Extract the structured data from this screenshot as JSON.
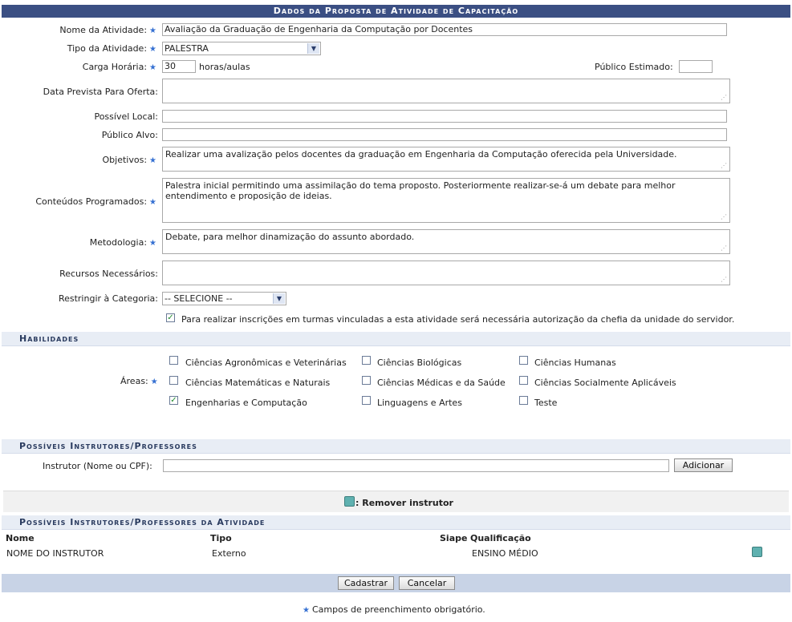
{
  "title": "Dados da Proposta de Atividade de Capacitação",
  "fields": {
    "nome_label": "Nome da Atividade:",
    "nome_value": "Avaliação da Graduação de Engenharia da Computação por Docentes",
    "tipo_label": "Tipo da Atividade:",
    "tipo_value": "PALESTRA",
    "carga_label": "Carga Horária:",
    "carga_value": "30",
    "carga_unit": "horas/aulas",
    "publico_estimado_label": "Público Estimado:",
    "publico_estimado_value": "",
    "data_prevista_label": "Data Prevista Para Oferta:",
    "data_prevista_value": "",
    "local_label": "Possível Local:",
    "local_value": "",
    "publico_alvo_label": "Público Alvo:",
    "publico_alvo_value": "",
    "objetivos_label": "Objetivos:",
    "objetivos_value": "Realizar uma avalização pelos docentes da graduação em Engenharia da Computação oferecida pela Universidade.",
    "conteudos_label": "Conteúdos Programados:",
    "conteudos_value": "Palestra inicial permitindo uma assimilação do tema proposto. Posteriormente realizar-se-á  um debate para melhor entendimento e proposição de ideias.",
    "metodologia_label": "Metodologia:",
    "metodologia_value": "Debate, para melhor dinamização do assunto abordado.",
    "recursos_label": "Recursos Necessários:",
    "recursos_value": "",
    "restringir_label": "Restringir à Categoria:",
    "restringir_value": "-- SELECIONE --",
    "autorizacao_text": "Para realizar inscrições em turmas vinculadas a esta atividade será necessária autorização da chefia da unidade do servidor.",
    "autorizacao_checked": true
  },
  "habilidades": {
    "section_title": "Habilidades",
    "areas_label": "Áreas:",
    "areas": [
      {
        "label": "Ciências Agronômicas e Veterinárias",
        "checked": false
      },
      {
        "label": "Ciências Biológicas",
        "checked": false
      },
      {
        "label": "Ciências Humanas",
        "checked": false
      },
      {
        "label": "Ciências Matemáticas e Naturais",
        "checked": false
      },
      {
        "label": "Ciências Médicas e da Saúde",
        "checked": false
      },
      {
        "label": "Ciências Socialmente Aplicáveis",
        "checked": false
      },
      {
        "label": "Engenharias e Computação",
        "checked": true
      },
      {
        "label": "Linguagens e Artes",
        "checked": false
      },
      {
        "label": "Teste",
        "checked": false
      }
    ]
  },
  "instrutores": {
    "section_title": "Possíveis Instrutores/Professores",
    "instrutor_label": "Instrutor (Nome ou CPF):",
    "instrutor_value": "",
    "adicionar_label": "Adicionar",
    "legend": ": Remover instrutor"
  },
  "tabela": {
    "section_title": "Possíveis Instrutores/Professores da Atividade",
    "headers": {
      "nome": "Nome",
      "tipo": "Tipo",
      "siape": "Siape",
      "qualificacao": "Qualificação"
    },
    "rows": [
      {
        "nome": "NOME DO INSTRUTOR",
        "tipo": "Externo",
        "siape": "",
        "qualificacao": "ENSINO MÉDIO"
      }
    ]
  },
  "buttons": {
    "cadastrar": "Cadastrar",
    "cancelar": "Cancelar"
  },
  "footer_note": "Campos de preenchimento obrigatório.",
  "colors": {
    "title_bar": "#3b4f83",
    "section_bg": "#e8edf5",
    "required_star": "#3570d2",
    "footer_bar": "#c8d3e6"
  }
}
